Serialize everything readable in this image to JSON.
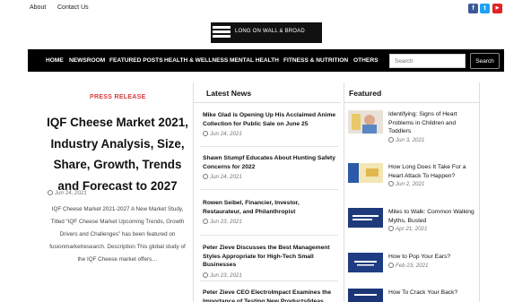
{
  "topbar": {
    "links": [
      "About",
      "Contact Us"
    ],
    "social": [
      {
        "name": "facebook-icon",
        "glyph": "f",
        "color": "#3b5998"
      },
      {
        "name": "twitter-icon",
        "glyph": "t",
        "color": "#1da1f2"
      },
      {
        "name": "youtube-icon",
        "glyph": "▶",
        "color": "#e02424"
      }
    ]
  },
  "logo": {
    "text": "LONG ON WALL & BROAD"
  },
  "nav": {
    "items": [
      "HOME",
      "NEWSROOM",
      "FEATURED POSTS",
      "HEALTH & WELLNESS",
      "MENTAL HEALTH",
      "FITNESS & NUTRITION",
      "OTHERS"
    ],
    "search_placeholder": "Search",
    "search_button": "Search"
  },
  "article": {
    "category": "PRESS RELEASE",
    "title": "IQF Cheese Market 2021, Industry Analysis, Size, Share, Growth, Trends and Forecast to 2027",
    "date": "Jun 24, 2021",
    "excerpt": "IQF Cheese Market 2021-2027 A New Market Study, Titled “IQF Cheese Market Upcoming Trends, Growth Drivers and Challenges” has been featured on fusionmarketresearch. Description This global study of the IQF Cheese market offers…"
  },
  "latest": {
    "heading": "Latest News",
    "items": [
      {
        "title": "Mike Glad is Opening Up His Acclaimed Anime Collection for Public Sale on June 25",
        "date": "Jun 24, 2021"
      },
      {
        "title": "Shawn Stumpf Educates About Hunting Safety Concerns for 2022",
        "date": "Jun 24, 2021"
      },
      {
        "title": "Rowen Seibel, Financier, Investor, Restaurateur, and Philanthropist",
        "date": "Jun 23, 2021"
      },
      {
        "title": "Peter Zieve Discusses the Best Management Styles Appropriate for High-Tech Small Businesses",
        "date": "Jun 23, 2021"
      },
      {
        "title": "Peter Zieve CEO ElectroImpact Examines the Importance of Testing New Products/Ideas Before",
        "date": ""
      }
    ]
  },
  "featured": {
    "heading": "Featured",
    "items": [
      {
        "title": "Identifying: Signs of Heart Problems in Children and Toddlers",
        "date": "Jun 3, 2021",
        "thumb_color": "#e9e2d8"
      },
      {
        "title": "How Long Does It Take For a Heart Attack To Happen?",
        "date": "Jun 2, 2021",
        "thumb_color": "#f2e7b5"
      },
      {
        "title": "Miles to Walk: Common Walking Myths, Busted",
        "date": "Apr 21, 2021",
        "thumb_color": "#1e3a7a"
      },
      {
        "title": "How to Pop Your Ears?",
        "date": "Feb 23, 2021",
        "thumb_color": "#1f3c82"
      },
      {
        "title": "How To Crack Your Back?",
        "date": "",
        "thumb_color": "#1c3577"
      }
    ]
  }
}
